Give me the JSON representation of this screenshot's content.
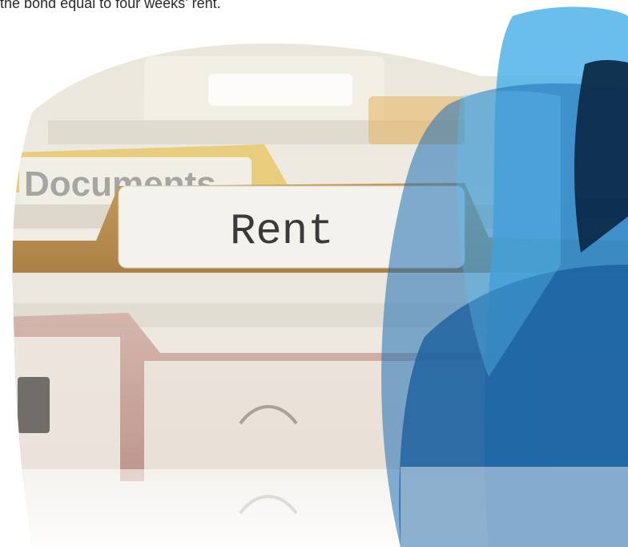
{
  "caption": {
    "text": "the bond equal to four weeks' rent."
  },
  "photo": {
    "front_tab_label": "Rent",
    "back_tab_label": "Documents"
  },
  "colors": {
    "caption_text": "#2b2b2b",
    "shape_light_blue": "#4fb3e8",
    "shape_mid_blue": "#1f6fb5",
    "shape_dark_navy": "#0c2b4a",
    "tab_kraft": "#b98d4f",
    "label_white": "#f4f2ec",
    "folder_pink": "#c9a39a",
    "folder_yellow": "#e6c86a"
  },
  "icons": [
    "blob-light-blue-shape",
    "blob-mid-blue-shape",
    "blob-dark-navy-shape"
  ]
}
